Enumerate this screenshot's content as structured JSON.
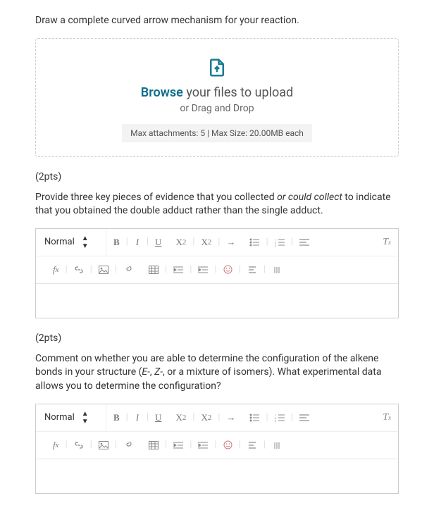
{
  "q1": {
    "instruction": "Draw a complete curved arrow mechanism for your reaction.",
    "upload": {
      "browse": "Browse",
      "title_rest": " your files to upload",
      "sub": "or Drag and Drop",
      "limits": "Max attachments: 5 | Max Size: 20.00MB each"
    }
  },
  "q2": {
    "points": "(2pts)",
    "instr_a": "Provide three key pieces of evidence that you collected ",
    "instr_italic": "or could collect",
    "instr_b": " to indicate that you obtained the double adduct rather than the single adduct."
  },
  "q3": {
    "points": "(2pts)",
    "instr_a": "Comment on whether you are able to determine the configuration of the alkene bonds in your structure (",
    "instr_i1": "E-",
    "instr_mid": ", ",
    "instr_i2": "Z-",
    "instr_b": ", or a mixture of isomers). What experimental data allows you to determine the configuration?"
  },
  "editor": {
    "style_select": "Normal",
    "bold": "B",
    "italic": "I",
    "underline": "U",
    "sub": "X",
    "sub2": "2",
    "sup": "X",
    "sup2": "2",
    "fx": "f",
    "fxx": "x",
    "clear": "T",
    "clearx": "x"
  }
}
